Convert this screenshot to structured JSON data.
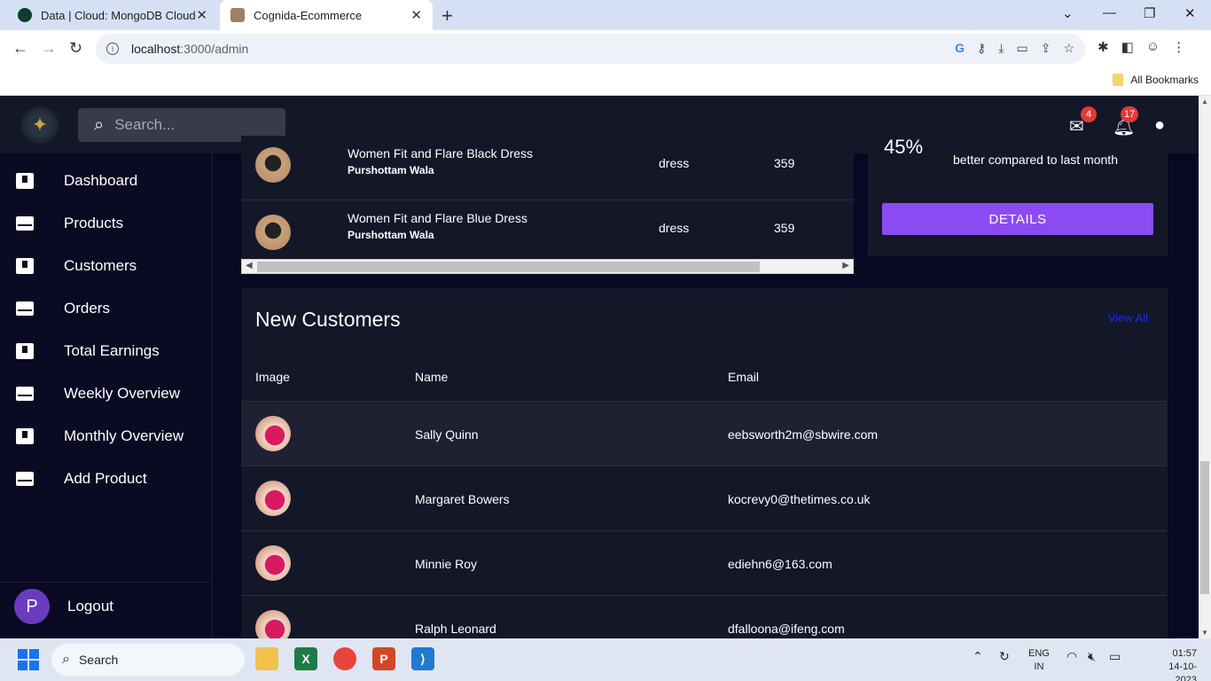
{
  "browser": {
    "tabs": [
      {
        "title": "Data | Cloud: MongoDB Cloud",
        "active": false
      },
      {
        "title": "Cognida-Ecommerce",
        "active": true
      }
    ],
    "url_host": "localhost",
    "url_path": ":3000/admin",
    "bookmarks_label": "All Bookmarks"
  },
  "app": {
    "search_placeholder": "Search...",
    "mail_count": "4",
    "notification_count": "17",
    "sidebar": {
      "items": [
        {
          "label": "Dashboard",
          "icon": "inbox-icon"
        },
        {
          "label": "Products",
          "icon": "mail-icon"
        },
        {
          "label": "Customers",
          "icon": "inbox-icon"
        },
        {
          "label": "Orders",
          "icon": "mail-icon"
        },
        {
          "label": "Total Earnings",
          "icon": "inbox-icon"
        },
        {
          "label": "Weekly Overview",
          "icon": "mail-icon"
        },
        {
          "label": "Monthly Overview",
          "icon": "inbox-icon"
        },
        {
          "label": "Add Product",
          "icon": "mail-icon"
        }
      ],
      "logout_initial": "P",
      "logout_label": "Logout"
    },
    "products": [
      {
        "name": "Women Fit and Flare Black Dress",
        "seller": "Purshottam Wala",
        "category": "dress",
        "price": "359"
      },
      {
        "name": "Women Fit and Flare Blue Dress",
        "seller": "Purshottam Wala",
        "category": "dress",
        "price": "359"
      }
    ],
    "summary": {
      "percent": "45%",
      "text": "better compared to last month",
      "details_label": "DETAILS"
    },
    "customers": {
      "title": "New Customers",
      "view_all": "View All",
      "headers": [
        "Image",
        "Name",
        "Email"
      ],
      "rows": [
        {
          "name": "Sally Quinn",
          "email": "eebsworth2m@sbwire.com"
        },
        {
          "name": "Margaret Bowers",
          "email": "kocrevy0@thetimes.co.uk"
        },
        {
          "name": "Minnie Roy",
          "email": "ediehn6@163.com"
        },
        {
          "name": "Ralph Leonard",
          "email": "dfalloona@ifeng.com"
        }
      ]
    }
  },
  "taskbar": {
    "search_label": "Search",
    "lang_line1": "ENG",
    "lang_line2": "IN",
    "time": "01:57",
    "date": "14-10-2023"
  }
}
